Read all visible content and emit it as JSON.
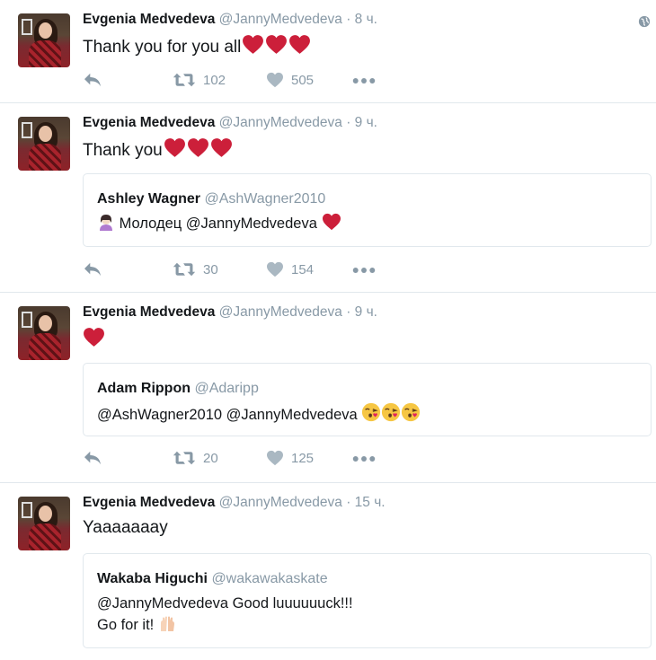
{
  "colors": {
    "heart": "#cc1f3a",
    "muted": "#8899a6",
    "divider": "#e1e8ed",
    "text": "#14171a"
  },
  "tweets": [
    {
      "name": "Evgenia Medvedeva",
      "handle": "@JannyMedvedeva",
      "time": "8 ч.",
      "text": "Thank you for you all",
      "hearts": 3,
      "retweets": "102",
      "likes": "505",
      "has_globe": true
    },
    {
      "name": "Evgenia Medvedeva",
      "handle": "@JannyMedvedeva",
      "time": "9 ч.",
      "text": "Thank you",
      "hearts": 3,
      "quote": {
        "name": "Ashley Wagner",
        "handle": "@AshWagner2010",
        "text": "Молодец @JannyMedvedeva"
      },
      "retweets": "30",
      "likes": "154"
    },
    {
      "name": "Evgenia Medvedeva",
      "handle": "@JannyMedvedeva",
      "time": "9 ч.",
      "text": "",
      "hearts": 1,
      "quote": {
        "name": "Adam Rippon",
        "handle": "@Adaripp",
        "text": "@AshWagner2010 @JannyMedvedeva"
      },
      "retweets": "20",
      "likes": "125"
    },
    {
      "name": "Evgenia Medvedeva",
      "handle": "@JannyMedvedeva",
      "time": "15 ч.",
      "text": "Yaaaaaaay",
      "quote": {
        "name": "Wakaba Higuchi",
        "handle": "@wakawakaskate",
        "text_line1": "@JannyMedvedeva Good luuuuuuck!!!",
        "text_line2": "Go for it!"
      }
    }
  ],
  "icons": {
    "reply": "reply-icon",
    "retweet": "retweet-icon",
    "like": "heart-icon",
    "more": "more-icon",
    "globe": "globe-icon"
  }
}
